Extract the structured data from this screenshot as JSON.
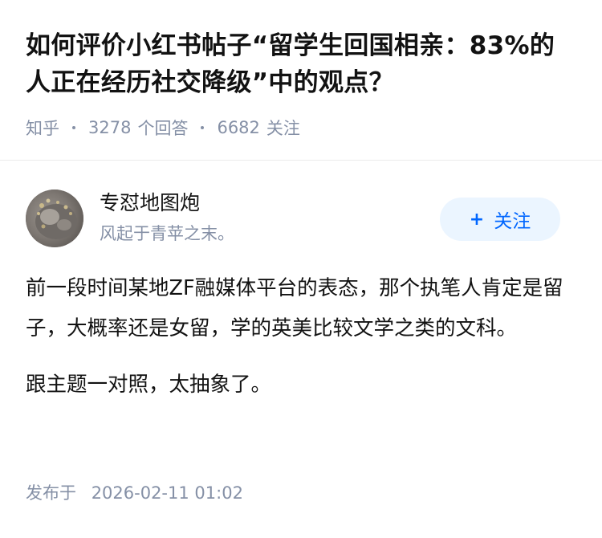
{
  "question": {
    "title": "如何评价小红书帖子“留学生回国相亲：83%的人正在经历社交降级”中的观点？",
    "source": "知乎",
    "answer_count": "3278",
    "answer_label": "个回答",
    "follower_count": "6682",
    "follower_label": "关注"
  },
  "answer": {
    "author": {
      "name": "专怼地图炮",
      "bio": "风起于青苹之末。",
      "avatar_icon": "avatar-image"
    },
    "follow_button": {
      "icon": "plus-icon",
      "label": "关注"
    },
    "paragraphs": [
      "前一段时间某地ZF融媒体平台的表态，那个执笔人肯定是留子，大概率还是女留，学的英美比较文学之类的文科。",
      "跟主题一对照，太抽象了。"
    ],
    "published_label": "发布于",
    "published_time": "2026-02-11 01:02"
  },
  "colors": {
    "text": "#121212",
    "meta": "#8590a6",
    "accent": "#0066ff",
    "accent_bg": "#ebf5ff",
    "divider": "#ebebeb"
  }
}
